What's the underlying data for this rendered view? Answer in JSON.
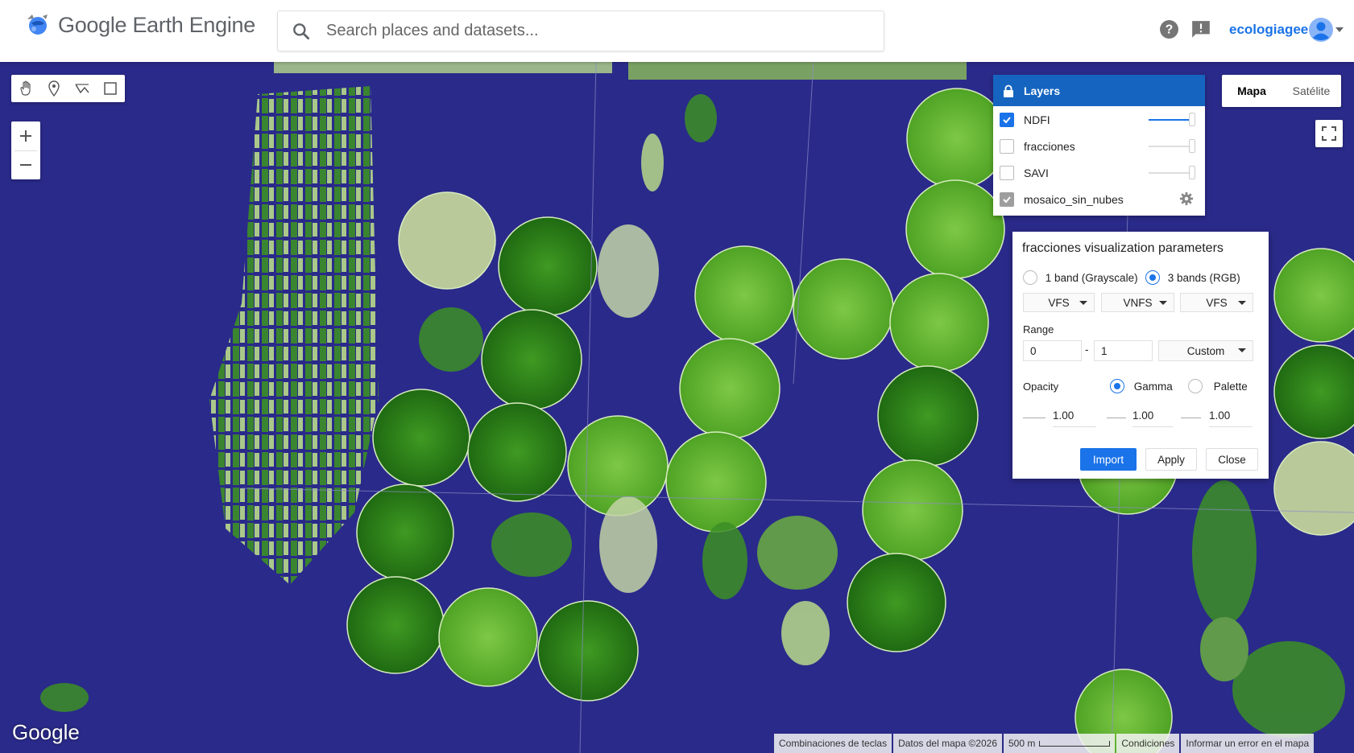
{
  "header": {
    "app_title": "Google Earth Engine",
    "search_placeholder": "Search places and datasets...",
    "username": "ecologiagee",
    "icons": [
      "gee-logo-icon",
      "search-icon",
      "help-icon",
      "feedback-icon",
      "account-avatar-icon"
    ]
  },
  "map_type": {
    "map_label": "Mapa",
    "satellite_label": "Satélite",
    "selected": "Mapa"
  },
  "layers": {
    "title": "Layers",
    "items": [
      {
        "name": "NDFI",
        "checked": true,
        "opacity": 1.0
      },
      {
        "name": "fracciones",
        "checked": false,
        "opacity": 1.0
      },
      {
        "name": "SAVI",
        "checked": false,
        "opacity": 1.0
      },
      {
        "name": "mosaico_sin_nubes",
        "checked": true,
        "has_settings": true
      }
    ]
  },
  "viz_panel": {
    "title": "fracciones visualization parameters",
    "band_mode_1": "1 band (Grayscale)",
    "band_mode_3": "3 bands (RGB)",
    "band_mode_selected": "3 bands (RGB)",
    "bands": [
      "VFS",
      "VNFS",
      "VFS"
    ],
    "range_label": "Range",
    "range_min": "0",
    "range_sep": "-",
    "range_max": "1",
    "range_mode": "Custom",
    "opacity_label": "Opacity",
    "gamma_label": "Gamma",
    "palette_label": "Palette",
    "stretch_selected": "Gamma",
    "gamma_values": [
      "1.00",
      "1.00",
      "1.00"
    ],
    "import_label": "Import",
    "apply_label": "Apply",
    "close_label": "Close"
  },
  "map_footer": {
    "watermark": "Google",
    "keyboard_shortcuts": "Combinaciones de teclas",
    "map_data": "Datos del mapa ©2026",
    "scale_label": "500 m",
    "terms": "Condiciones",
    "report_error": "Informar un error en el mapa"
  },
  "colors": {
    "map_background": "#2a2a8a",
    "vegetation_dark": "#2e7d1e",
    "vegetation_light": "#7dc242",
    "accent_blue": "#1a73e8",
    "layers_header": "#1565c0"
  }
}
